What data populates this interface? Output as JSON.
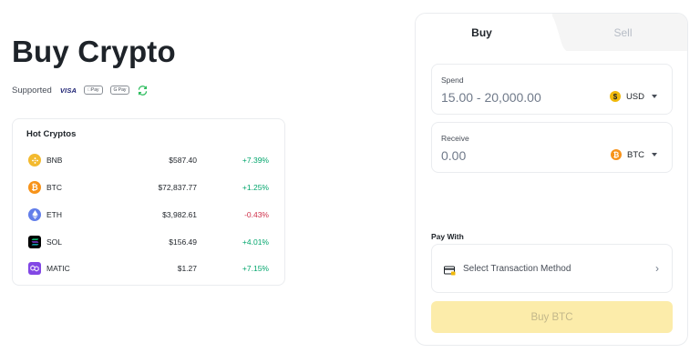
{
  "page_title": "Buy Crypto",
  "supported": {
    "label": "Supported",
    "methods": [
      "VISA",
      "Apple Pay",
      "G Pay"
    ],
    "logo_texts": {
      "visa": "VISA",
      "apple": "Pay",
      "gpay": "G Pay"
    }
  },
  "hot_cryptos": {
    "title": "Hot Cryptos",
    "rows": [
      {
        "symbol": "BNB",
        "price": "$587.40",
        "change": "+7.39%",
        "direction": "up",
        "icon": "bnb-icon",
        "color": "#f3ba2f"
      },
      {
        "symbol": "BTC",
        "price": "$72,837.77",
        "change": "+1.25%",
        "direction": "up",
        "icon": "btc-icon",
        "color": "#f7931a"
      },
      {
        "symbol": "ETH",
        "price": "$3,982.61",
        "change": "-0.43%",
        "direction": "down",
        "icon": "eth-icon",
        "color": "#627eea"
      },
      {
        "symbol": "SOL",
        "price": "$156.49",
        "change": "+4.01%",
        "direction": "up",
        "icon": "sol-icon",
        "color": "#000000"
      },
      {
        "symbol": "MATIC",
        "price": "$1.27",
        "change": "+7.15%",
        "direction": "up",
        "icon": "matic-icon",
        "color": "#8247e5"
      }
    ]
  },
  "trade": {
    "tabs": {
      "buy": "Buy",
      "sell": "Sell",
      "active": "buy"
    },
    "spend": {
      "label": "Spend",
      "placeholder": "15.00 - 20,000.00",
      "currency": "USD",
      "currency_icon": "usd-icon",
      "currency_color": "#f0b90b"
    },
    "receive": {
      "label": "Receive",
      "placeholder": "0.00",
      "currency": "BTC",
      "currency_icon": "btc-icon",
      "currency_color": "#f7931a"
    },
    "pay_with": {
      "label": "Pay With",
      "method_text": "Select Transaction Method"
    },
    "submit_label": "Buy BTC"
  },
  "colors": {
    "accent": "#f0b90b",
    "up": "#03a66d",
    "down": "#cf304a",
    "button_disabled": "#fcecaa"
  }
}
